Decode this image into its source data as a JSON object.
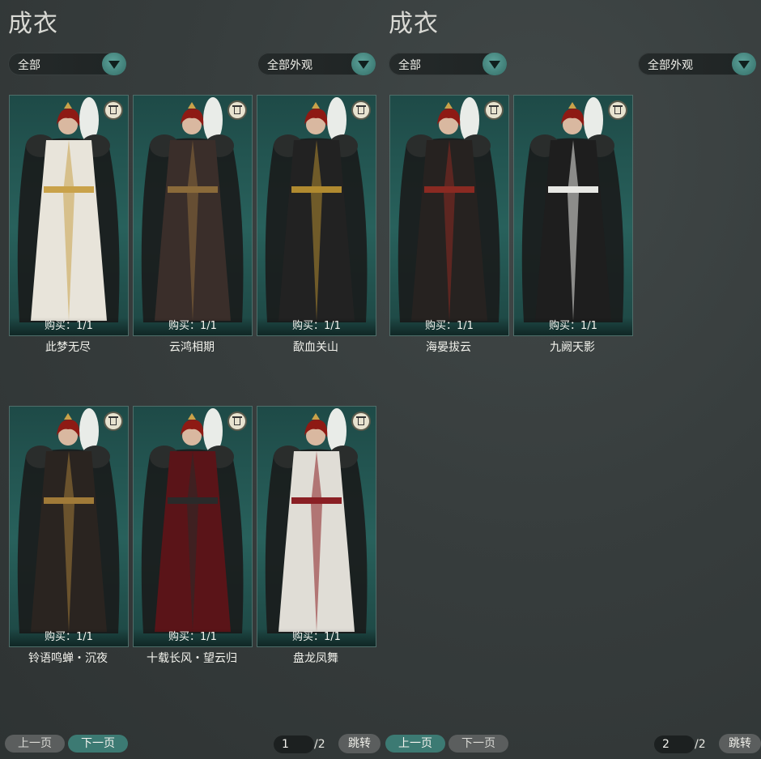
{
  "left": {
    "title": "成衣",
    "filter1": "全部",
    "filter2": "全部外观",
    "items": [
      {
        "name": "此梦无尽",
        "buy": "购买：1/1",
        "robe": "#e8e4da",
        "accent": "#c9a24a"
      },
      {
        "name": "云鸿相期",
        "buy": "购买：1/1",
        "robe": "#3a2e2a",
        "accent": "#8a6a3a"
      },
      {
        "name": "歃血关山",
        "buy": "购买：1/1",
        "robe": "#222222",
        "accent": "#b08a30"
      },
      {
        "name": "铃语鸣蝉・沉夜",
        "buy": "购买：1/1",
        "robe": "#2a2420",
        "accent": "#a07a38"
      },
      {
        "name": "十载长风・望云归",
        "buy": "购买：1/1",
        "robe": "#5a1418",
        "accent": "#2a2a2a"
      },
      {
        "name": "盘龙凤舞",
        "buy": "购买：1/1",
        "robe": "#e0ddd6",
        "accent": "#8a1f24"
      }
    ],
    "prev": "上一页",
    "next": "下一页",
    "page": "1",
    "total": "/2",
    "jump": "跳转"
  },
  "right": {
    "title": "成衣",
    "filter1": "全部",
    "filter2": "全部外观",
    "items": [
      {
        "name": "海晏拔云",
        "buy": "购买：1/1",
        "robe": "#262220",
        "accent": "#8a2a22"
      },
      {
        "name": "九阙天影",
        "buy": "购买：1/1",
        "robe": "#1e1e1e",
        "accent": "#e8e8e4"
      }
    ],
    "prev": "上一页",
    "next": "下一页",
    "page": "2",
    "total": "/2",
    "jump": "跳转"
  }
}
